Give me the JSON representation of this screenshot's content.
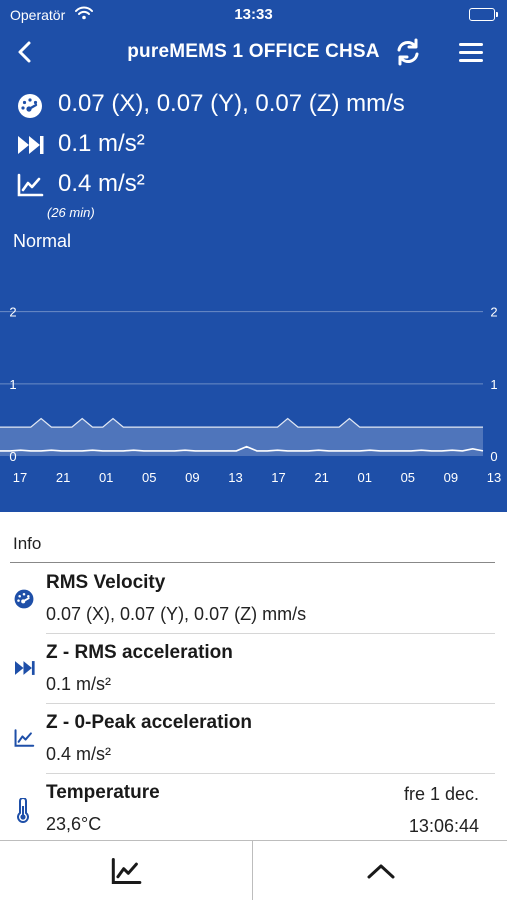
{
  "status_bar": {
    "carrier": "Operatör",
    "time": "13:33",
    "battery_level": 1.0
  },
  "nav": {
    "title": "pureMEMS 1 OFFICE CHSA"
  },
  "summary": {
    "velocity": "0.07 (X), 0.07 (Y), 0.07 (Z) mm/s",
    "rms_acceleration": "0.1 m/s²",
    "peak_acceleration": "0.4 m/s²",
    "duration": "(26 min)",
    "state": "Normal"
  },
  "chart_data": {
    "type": "line",
    "x_tick_labels": [
      "17",
      "21",
      "01",
      "05",
      "09",
      "13",
      "17",
      "21",
      "01",
      "05",
      "09",
      "13"
    ],
    "y_tick_labels": [
      "0",
      "1",
      "2"
    ],
    "ylim": [
      0,
      2.3
    ],
    "grid": true,
    "series": [
      {
        "values": [
          0.4,
          0.4,
          0.4,
          0.4,
          0.52,
          0.4,
          0.4,
          0.4,
          0.52,
          0.4,
          0.4,
          0.52,
          0.4,
          0.4,
          0.4,
          0.4,
          0.4,
          0.4,
          0.4,
          0.4,
          0.4,
          0.4,
          0.4,
          0.4,
          0.4,
          0.4,
          0.4,
          0.4,
          0.52,
          0.4,
          0.4,
          0.4,
          0.4,
          0.4,
          0.52,
          0.4,
          0.4,
          0.4,
          0.4,
          0.4,
          0.4,
          0.4,
          0.4,
          0.4,
          0.4,
          0.4,
          0.4,
          0.4
        ]
      },
      {
        "values": [
          0.07,
          0.07,
          0.08,
          0.07,
          0.07,
          0.08,
          0.07,
          0.07,
          0.07,
          0.08,
          0.07,
          0.07,
          0.07,
          0.08,
          0.07,
          0.07,
          0.07,
          0.07,
          0.08,
          0.07,
          0.07,
          0.07,
          0.07,
          0.07,
          0.13,
          0.07,
          0.07,
          0.08,
          0.07,
          0.07,
          0.07,
          0.08,
          0.07,
          0.07,
          0.07,
          0.07,
          0.08,
          0.07,
          0.07,
          0.07,
          0.07,
          0.08,
          0.07,
          0.07,
          0.08,
          0.07,
          0.1,
          0.07
        ]
      }
    ]
  },
  "info": {
    "header": "Info",
    "rows": [
      {
        "label": "RMS Velocity",
        "value": "0.07 (X), 0.07 (Y), 0.07 (Z) mm/s",
        "icon": "gauge-icon"
      },
      {
        "label": "Z - RMS acceleration",
        "value": "0.1 m/s²",
        "icon": "fast-forward-icon"
      },
      {
        "label": "Z - 0-Peak acceleration",
        "value": "0.4 m/s²",
        "icon": "line-chart-icon"
      },
      {
        "label": "Temperature",
        "value": "23,6°C",
        "icon": "thermometer-icon",
        "date": "fre 1 dec.",
        "time": "13:06:44"
      }
    ]
  },
  "bottom_bar": {
    "left_icon": "line-chart-icon",
    "right_icon": "chevron-up-icon"
  },
  "colors": {
    "header_bg": "#1e4fa8",
    "accent": "#1e4fa8",
    "text": "#1a1a1a"
  }
}
